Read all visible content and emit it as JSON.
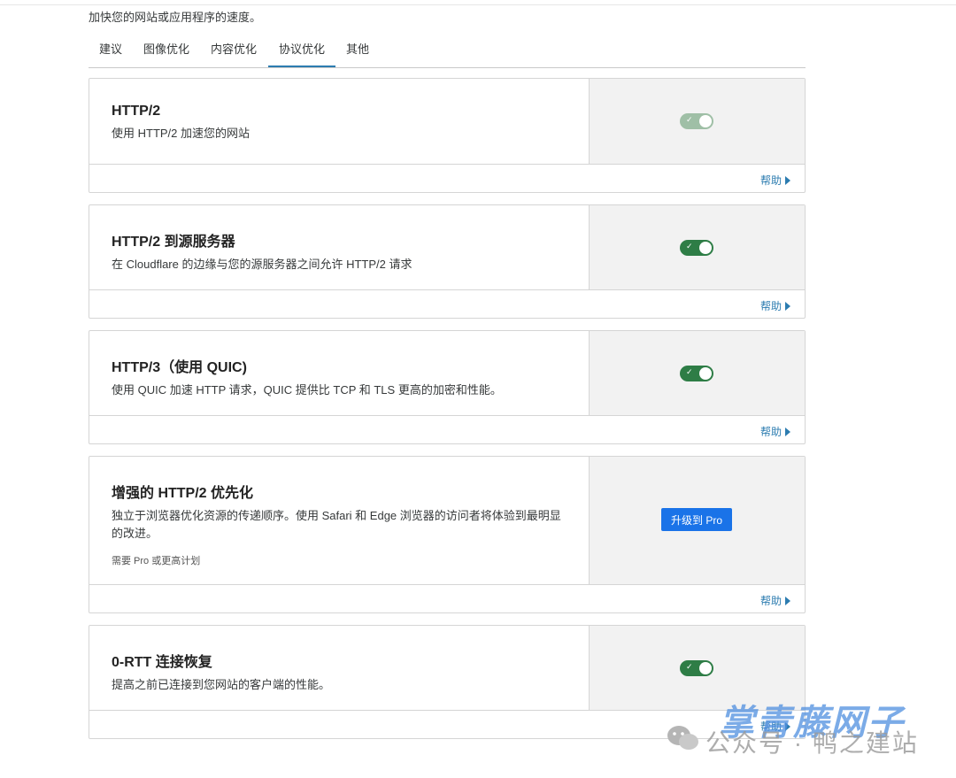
{
  "subtitle": "加快您的网站或应用程序的速度。",
  "tabs": [
    {
      "label": "建议"
    },
    {
      "label": "图像优化"
    },
    {
      "label": "内容优化"
    },
    {
      "label": "协议优化",
      "active": true
    },
    {
      "label": "其他"
    }
  ],
  "cards": [
    {
      "title": "HTTP/2",
      "desc": "使用 HTTP/2 加速您的网站",
      "toggle": "on-disabled",
      "help": "帮助"
    },
    {
      "title": "HTTP/2 到源服务器",
      "desc": "在 Cloudflare 的边缘与您的源服务器之间允许 HTTP/2 请求",
      "toggle": "on",
      "help": "帮助"
    },
    {
      "title": "HTTP/3（使用 QUIC)",
      "desc": "使用 QUIC 加速 HTTP 请求，QUIC 提供比 TCP 和 TLS 更高的加密和性能。",
      "toggle": "on",
      "help": "帮助"
    },
    {
      "title": "增强的 HTTP/2 优先化",
      "desc": "独立于浏览器优化资源的传递顺序。使用 Safari 和 Edge 浏览器的访问者将体验到最明显的改进。",
      "note": "需要 Pro 或更高计划",
      "button": "升级到 Pro",
      "help": "帮助"
    },
    {
      "title": "0-RTT 连接恢复",
      "desc": "提高之前已连接到您网站的客户端的性能。",
      "toggle": "on",
      "help": "帮助"
    }
  ],
  "watermark": {
    "top": "掌青藤网子",
    "bottom": "公众号 · 鸭之建站"
  },
  "colors": {
    "toggle_on": "#2e7d46",
    "toggle_disabled": "#9fbfa6",
    "link": "#2c7cb0",
    "button": "#1a73e8"
  }
}
